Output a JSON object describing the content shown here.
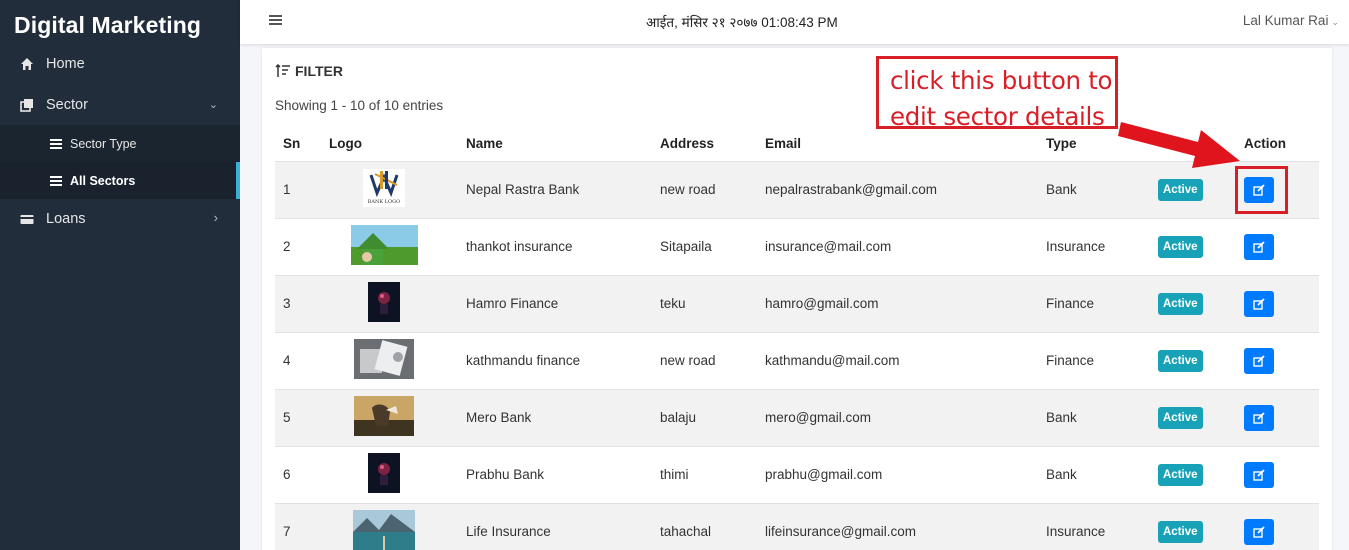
{
  "app": {
    "title": "Digital Marketing"
  },
  "sidebar": {
    "items": [
      {
        "label": "Home",
        "icon": "home-icon"
      },
      {
        "label": "Sector",
        "icon": "sector-icon",
        "expanded": true,
        "children": [
          {
            "label": "Sector Type"
          },
          {
            "label": "All Sectors",
            "active": true
          }
        ]
      },
      {
        "label": "Loans",
        "icon": "loan-icon"
      }
    ]
  },
  "header": {
    "datetime": "आईत, मंसिर २१ २०७७ 01:08:43 PM",
    "user": "Lal Kumar Rai"
  },
  "filter": {
    "label": "FILTER"
  },
  "showing": "Showing 1 - 10 of 10 entries",
  "table": {
    "columns": [
      "Sn",
      "Logo",
      "Name",
      "Address",
      "Email",
      "Type",
      "",
      "Action"
    ],
    "rows": [
      {
        "sn": "1",
        "name": "Nepal Rastra Bank",
        "address": "new road",
        "email": "nepalrastrabank@gmail.com",
        "type": "Bank",
        "status": "Active",
        "logo_text": "BANK LOGO"
      },
      {
        "sn": "2",
        "name": "thankot insurance",
        "address": "Sitapaila",
        "email": "insurance@mail.com",
        "type": "Insurance",
        "status": "Active"
      },
      {
        "sn": "3",
        "name": "Hamro Finance",
        "address": "teku",
        "email": "hamro@gmail.com",
        "type": "Finance",
        "status": "Active"
      },
      {
        "sn": "4",
        "name": "kathmandu finance",
        "address": "new road",
        "email": "kathmandu@mail.com",
        "type": "Finance",
        "status": "Active"
      },
      {
        "sn": "5",
        "name": "Mero Bank",
        "address": "balaju",
        "email": "mero@gmail.com",
        "type": "Bank",
        "status": "Active"
      },
      {
        "sn": "6",
        "name": "Prabhu Bank",
        "address": "thimi",
        "email": "prabhu@gmail.com",
        "type": "Bank",
        "status": "Active"
      },
      {
        "sn": "7",
        "name": "Life Insurance",
        "address": "tahachal",
        "email": "lifeinsurance@gmail.com",
        "type": "Insurance",
        "status": "Active"
      }
    ]
  },
  "annotation": {
    "line1": "click this button to",
    "line2": "edit sector details",
    "color": "#d81f27"
  },
  "colors": {
    "sidebar": "#212d3a",
    "badge": "#17a2b8",
    "edit_button": "#007bff"
  }
}
